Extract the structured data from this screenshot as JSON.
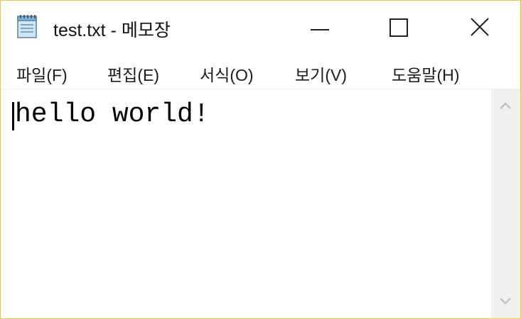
{
  "window": {
    "title": "test.txt - 메모장",
    "controls": {
      "minimize_icon": "minimize-icon",
      "maximize_icon": "maximize-icon",
      "close_icon": "close-icon"
    }
  },
  "menu": {
    "items": [
      {
        "label": "파일(F)"
      },
      {
        "label": "편집(E)"
      },
      {
        "label": "서식(O)"
      },
      {
        "label": "보기(V)"
      },
      {
        "label": "도움말(H)"
      }
    ]
  },
  "editor": {
    "content": "hello world!"
  },
  "scrollbar": {
    "up_icon": "chevron-up-icon",
    "down_icon": "chevron-down-icon"
  },
  "colors": {
    "window_border": "#e8c84a",
    "scrollbar_track": "#f0f0f0"
  }
}
